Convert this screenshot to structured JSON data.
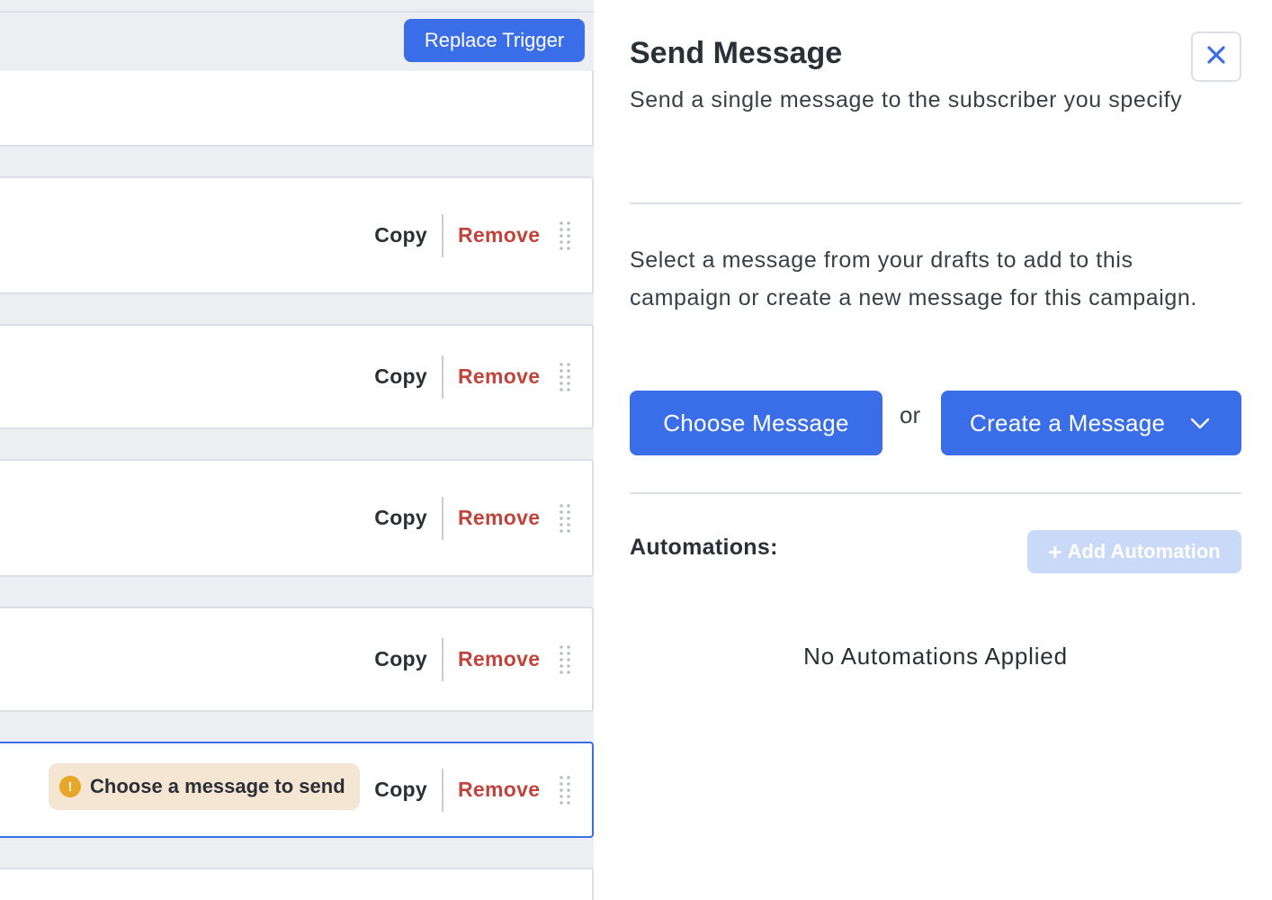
{
  "canvas": {
    "replace_trigger_label": "Replace Trigger",
    "steps": [
      {
        "copy": "Copy",
        "remove": "Remove"
      },
      {
        "copy": "Copy",
        "remove": "Remove"
      },
      {
        "copy": "Copy",
        "remove": "Remove"
      },
      {
        "copy": "Copy",
        "remove": "Remove"
      },
      {
        "copy": "Copy",
        "remove": "Remove",
        "warning": "Choose a message to send"
      }
    ],
    "warning_icon": "!",
    "colors": {
      "accent": "#3a6ee8",
      "remove": "#c0443b",
      "warning_bg": "#f5e6d3",
      "warning_icon": "#e8a628"
    }
  },
  "panel": {
    "title": "Send Message",
    "description": "Send a single message to the subscriber you specify",
    "select_text": "Select a message from your drafts to add to this campaign or create a new message for this campaign.",
    "choose_label": "Choose Message",
    "or_label": "or",
    "create_label": "Create a Message",
    "automations_label": "Automations:",
    "add_automation_label": "Add Automation",
    "add_automation_icon": "+",
    "no_automations": "No Automations Applied",
    "icons": {
      "close": "close-icon",
      "chevron": "chevron-down-icon",
      "plus": "plus-icon"
    }
  }
}
